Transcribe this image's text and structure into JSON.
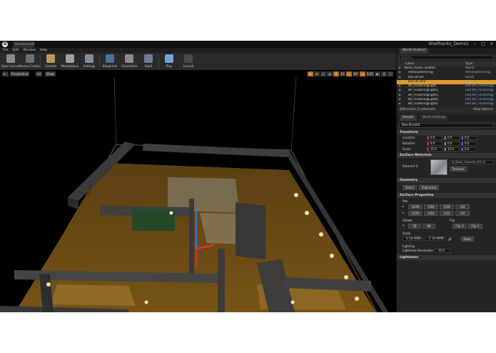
{
  "window": {
    "doc_tab": "DemoLevel1",
    "project_title": "Shellhacks_Demo1"
  },
  "menu": [
    "File",
    "Edit",
    "Window",
    "Help"
  ],
  "toolbar": [
    {
      "name": "save-current-button",
      "label": "Save Current",
      "color": "#8a8a8a"
    },
    {
      "name": "source-control-button",
      "label": "Source Control",
      "color": "#6f6f6f"
    },
    {
      "name": "content-button",
      "label": "Content",
      "color": "#b89b5a"
    },
    {
      "name": "marketplace-button",
      "label": "Marketplace",
      "color": "#9aa0a6"
    },
    {
      "name": "settings-button",
      "label": "Settings",
      "color": "#7f8c99"
    },
    {
      "name": "blueprints-button",
      "label": "Blueprints",
      "color": "#4f6fa0"
    },
    {
      "name": "cinematics-button",
      "label": "Cinematics",
      "color": "#8a8a8a"
    },
    {
      "name": "build-button",
      "label": "Build",
      "color": "#6d7f94"
    },
    {
      "name": "play-button",
      "label": "Play",
      "color": "#6ea4dc"
    },
    {
      "name": "launch-button",
      "label": "Launch",
      "color": "#4a4a4a"
    }
  ],
  "viewport": {
    "perspective": "Perspective",
    "lit": "Lit",
    "show": "Show",
    "grid_snap": "10",
    "rot_snap": "10°",
    "scale_snap": "0.25",
    "cam_speed": "4"
  },
  "outliner": {
    "tab": "World Outliner",
    "search_placeholder": "Search...",
    "col_label": "Label",
    "col_type": "Type",
    "rows": [
      {
        "label": "demo_level1 (Editor)",
        "type": "World",
        "link": false,
        "selected": false
      },
      {
        "label": "AtmosphericFog",
        "type": "AtmosphericFog",
        "link": false,
        "selected": false
      },
      {
        "label": "Box Brush",
        "type": "Brush",
        "link": false,
        "selected": false
      },
      {
        "label": "Box Brush2",
        "type": "Brush",
        "link": false,
        "selected": true
      },
      {
        "label": "BP_FlickeringLight",
        "type": "Edit BP_FlickeringL",
        "link": true,
        "selected": false
      },
      {
        "label": "BP_FlickeringLight2",
        "type": "Edit BP_FlickeringL",
        "link": true,
        "selected": false
      },
      {
        "label": "BP_FlickeringLight3",
        "type": "Edit BP_FlickeringL",
        "link": true,
        "selected": false
      },
      {
        "label": "BP_FlickeringLight4",
        "type": "Edit BP_FlickeringL",
        "link": true,
        "selected": false
      },
      {
        "label": "BP_FlickeringLight5",
        "type": "Edit BP_FlickeringL",
        "link": true,
        "selected": false
      }
    ],
    "actor_count": "208 actors (1 selected)",
    "view_options": "View Options"
  },
  "details": {
    "tab": "Details",
    "tab2": "World Settings",
    "selected_name": "Box Brush2",
    "transform": {
      "title": "Transform",
      "location_label": "Location",
      "rotation_label": "Rotation",
      "scale_label": "Scale",
      "location": [
        "0.0",
        "0.0",
        "0.0"
      ],
      "rotation": [
        "0.0",
        "0.0",
        "0.0"
      ],
      "scale": [
        "15.0",
        "15.0",
        "0.0"
      ]
    },
    "surface_materials": {
      "title": "Surface Materials",
      "element_label": "Element 0",
      "material_name": "M_Stone_Concrete_002_M",
      "textures_button": "Textures"
    },
    "geometry": {
      "title": "Geometry",
      "select_button": "Select",
      "alignment_button": "Alignment"
    },
    "surface_properties": {
      "title": "Surface Properties",
      "pan_label": "Pan",
      "pan_u": [
        "1/256",
        "1/64",
        "1/16",
        "1/4"
      ],
      "pan_v": [
        "1/256",
        "1/64",
        "1/16",
        "1/4"
      ],
      "rotate_label": "Rotate",
      "rotate_values": [
        "45",
        "90"
      ],
      "flip_label": "Flip",
      "flip_u": "Flip U",
      "flip_v": "Flip V",
      "scale_label": "Scale",
      "scale_u": "U 14.9999",
      "scale_v": "V 14.9999",
      "apply_button": "Apply"
    },
    "lighting": {
      "title": "Lighting",
      "resolution_label": "Lightmap Resolution",
      "resolution_value": "32.0"
    },
    "lightmass": {
      "title": "Lightmass"
    }
  }
}
